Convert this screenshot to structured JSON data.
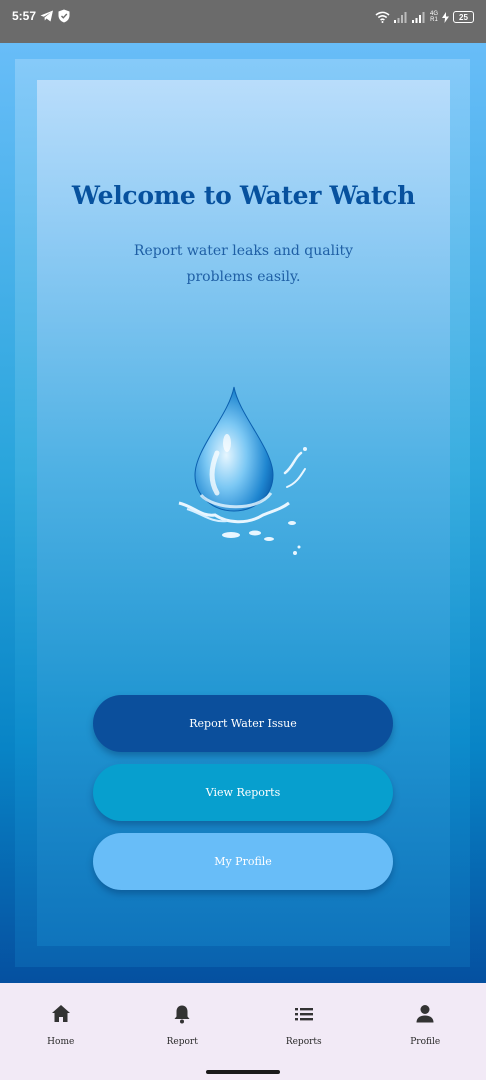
{
  "status_bar": {
    "time": "5:57",
    "network_label_top": "4G",
    "network_label_bottom": "R1",
    "battery": "25"
  },
  "main": {
    "title": "Welcome to Water Watch",
    "subtitle": "Report water leaks and quality problems easily.",
    "illustration_icon": "water-drop-icon",
    "buttons": [
      {
        "label": "Report Water Issue",
        "color": "#0b4f9c"
      },
      {
        "label": "View Reports",
        "color": "#079fce"
      },
      {
        "label": "My Profile",
        "color": "#68bdf8"
      }
    ]
  },
  "bottom_nav": {
    "items": [
      {
        "label": "Home",
        "icon": "home-icon"
      },
      {
        "label": "Report",
        "icon": "bell-icon"
      },
      {
        "label": "Reports",
        "icon": "list-icon"
      },
      {
        "label": "Profile",
        "icon": "person-icon"
      }
    ]
  },
  "colors": {
    "title": "#07519e",
    "accent_dark": "#0b4f9c",
    "accent_mid": "#079fce",
    "accent_light": "#68bdf8",
    "nav_background": "#f2eaf6"
  }
}
